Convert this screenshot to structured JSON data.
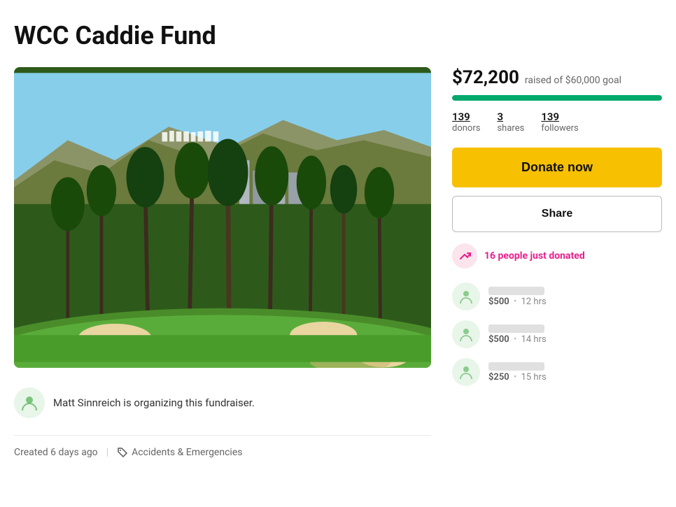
{
  "page": {
    "title": "WCC Caddie Fund",
    "background_color": "#fff"
  },
  "campaign": {
    "amount_raised": "$72,200",
    "goal_text": "raised of $60,000 goal",
    "progress_percent": 120,
    "progress_display": "100",
    "stats": {
      "donors": {
        "value": "139",
        "label": "donors"
      },
      "shares": {
        "value": "3",
        "label": "shares"
      },
      "followers": {
        "value": "139",
        "label": "followers"
      }
    },
    "donate_button": "Donate now",
    "share_button": "Share",
    "trending": "16 people just donated",
    "organizer_text": "Matt Sinnreich is organizing this fundraiser.",
    "created": "Created 6 days ago",
    "category": "Accidents & Emergencies"
  },
  "donors": [
    {
      "amount": "$500",
      "time": "12 hrs"
    },
    {
      "amount": "$500",
      "time": "14 hrs"
    },
    {
      "amount": "$250",
      "time": "15 hrs"
    }
  ],
  "icons": {
    "person": "👤",
    "trending": "↗",
    "tag": "🏷"
  }
}
